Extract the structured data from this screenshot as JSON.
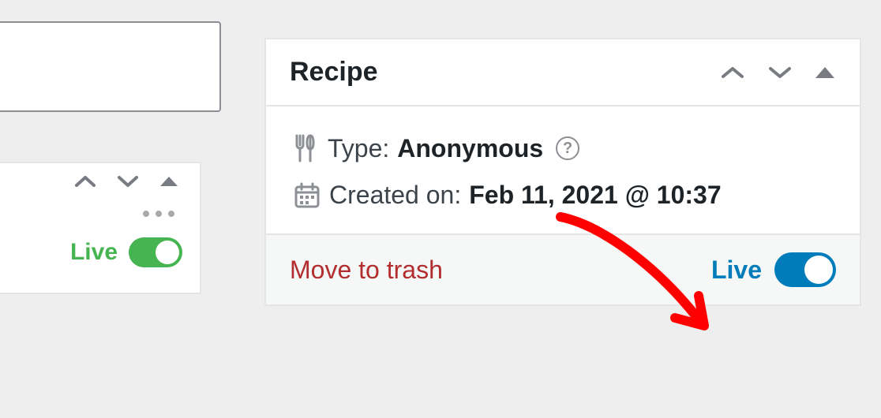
{
  "left_panel_b": {
    "live_label": "Live",
    "toggle_on": true
  },
  "main": {
    "title": "Recipe",
    "type_label": "Type:",
    "type_value": "Anonymous",
    "created_label": "Created on:",
    "created_value": "Feb 11, 2021 @ 10:37",
    "trash_label": "Move to trash",
    "live_label": "Live",
    "live_toggle_on": true
  }
}
